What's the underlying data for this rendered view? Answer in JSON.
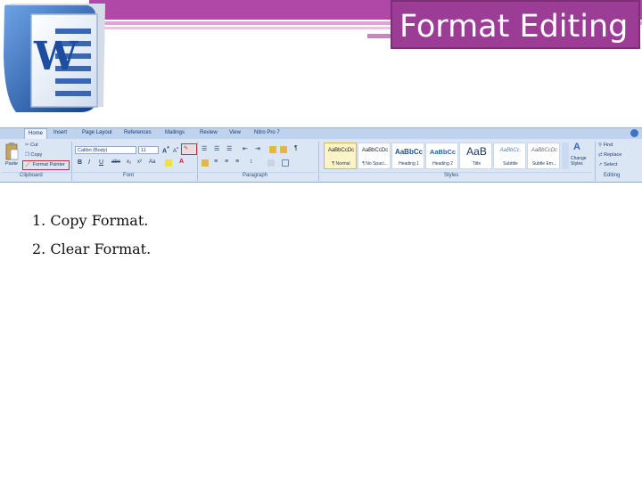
{
  "slide": {
    "title": "Format Editing",
    "items": [
      "1. Copy Format.",
      "2. Clear Format."
    ]
  },
  "logo": {
    "letter": "W"
  },
  "ribbon": {
    "tabs": [
      "Home",
      "Insert",
      "Page Layout",
      "References",
      "Mailings",
      "Review",
      "View",
      "Nitro Pro 7"
    ],
    "active_tab": "Home",
    "clipboard": {
      "group_label": "Clipboard",
      "paste": "Paste",
      "cut": "Cut",
      "copy": "Copy",
      "format_painter": "Format Painter"
    },
    "font": {
      "group_label": "Font",
      "font_name": "Calibri (Body)",
      "font_size": "11"
    },
    "paragraph": {
      "group_label": "Paragraph"
    },
    "styles": {
      "group_label": "Styles",
      "tiles": [
        {
          "preview": "AaBbCcDc",
          "name": "¶ Normal"
        },
        {
          "preview": "AaBbCcDc",
          "name": "¶ No Spaci..."
        },
        {
          "preview": "AaBbCc",
          "name": "Heading 1"
        },
        {
          "preview": "AaBbCc",
          "name": "Heading 2"
        },
        {
          "preview": "AaB",
          "name": "Title"
        },
        {
          "preview": "AaBbCc.",
          "name": "Subtitle"
        },
        {
          "preview": "AaBbCcDc",
          "name": "Subtle Em..."
        }
      ],
      "change_styles": "Change Styles"
    },
    "editing": {
      "group_label": "Editing",
      "find": "Find",
      "replace": "Replace",
      "select": "Select"
    }
  },
  "colors": {
    "accent": "#9b3d95",
    "highlight": "#c0304a",
    "ribbon_bg": "#dbe6f4"
  }
}
